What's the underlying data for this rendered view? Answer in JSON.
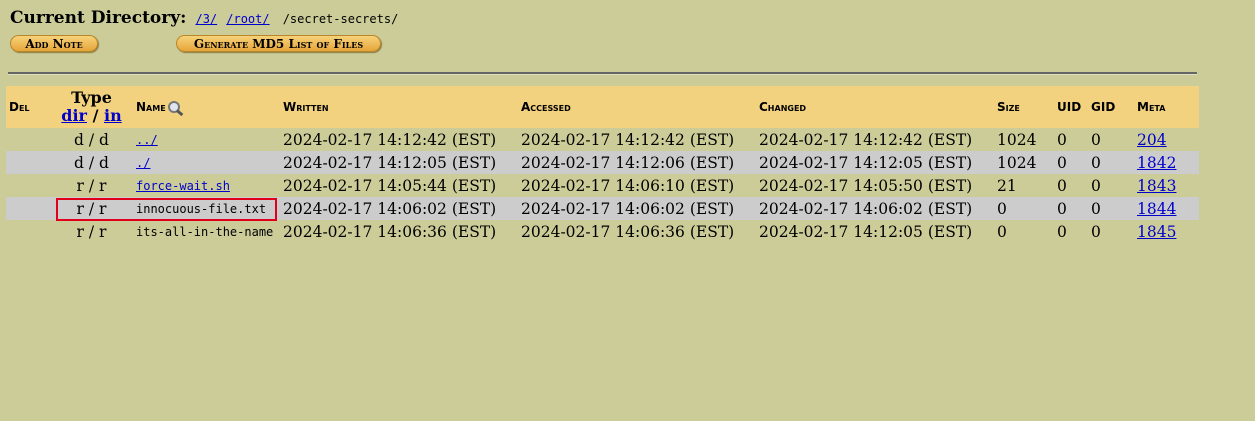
{
  "header": {
    "label": "Current Directory:",
    "crumbs": [
      "/3/",
      "/root/"
    ],
    "current": "/secret-secrets/"
  },
  "buttons": {
    "add_note": "Add Note",
    "generate_md5": "Generate MD5 List of Files"
  },
  "table": {
    "headers": {
      "del": "Del",
      "type_title": "Type",
      "type_dir": "dir",
      "type_sep": "/",
      "type_in": "in",
      "name": "Name",
      "written": "Written",
      "accessed": "Accessed",
      "changed": "Changed",
      "size": "Size",
      "uid": "UID",
      "gid": "GID",
      "meta": "Meta"
    },
    "rows": [
      {
        "type": "d / d",
        "name": "../",
        "written": "2024-02-17 14:12:42 (EST)",
        "accessed": "2024-02-17 14:12:42 (EST)",
        "changed": "2024-02-17 14:12:42 (EST)",
        "size": "1024",
        "uid": "0",
        "gid": "0",
        "meta": "204"
      },
      {
        "type": "d / d",
        "name": "./",
        "written": "2024-02-17 14:12:05 (EST)",
        "accessed": "2024-02-17 14:12:06 (EST)",
        "changed": "2024-02-17 14:12:05 (EST)",
        "size": "1024",
        "uid": "0",
        "gid": "0",
        "meta": "1842"
      },
      {
        "type": "r / r",
        "name": "force-wait.sh",
        "written": "2024-02-17 14:05:44 (EST)",
        "accessed": "2024-02-17 14:06:10 (EST)",
        "changed": "2024-02-17 14:05:50 (EST)",
        "size": "21",
        "uid": "0",
        "gid": "0",
        "meta": "1843"
      },
      {
        "type": "r / r",
        "name": "innocuous-file.txt",
        "written": "2024-02-17 14:06:02 (EST)",
        "accessed": "2024-02-17 14:06:02 (EST)",
        "changed": "2024-02-17 14:06:02 (EST)",
        "size": "0",
        "uid": "0",
        "gid": "0",
        "meta": "1844"
      },
      {
        "type": "r / r",
        "name": "its-all-in-the-name",
        "written": "2024-02-17 14:06:36 (EST)",
        "accessed": "2024-02-17 14:06:36 (EST)",
        "changed": "2024-02-17 14:12:05 (EST)",
        "size": "0",
        "uid": "0",
        "gid": "0",
        "meta": "1845"
      }
    ]
  },
  "icons": {
    "name_sort": "magnifier-icon"
  },
  "colors": {
    "background": "#cccc99",
    "header_row": "#f3d27f",
    "alt_row": "#cccccc",
    "link": "#0000cc",
    "highlight": "#e0001a"
  }
}
